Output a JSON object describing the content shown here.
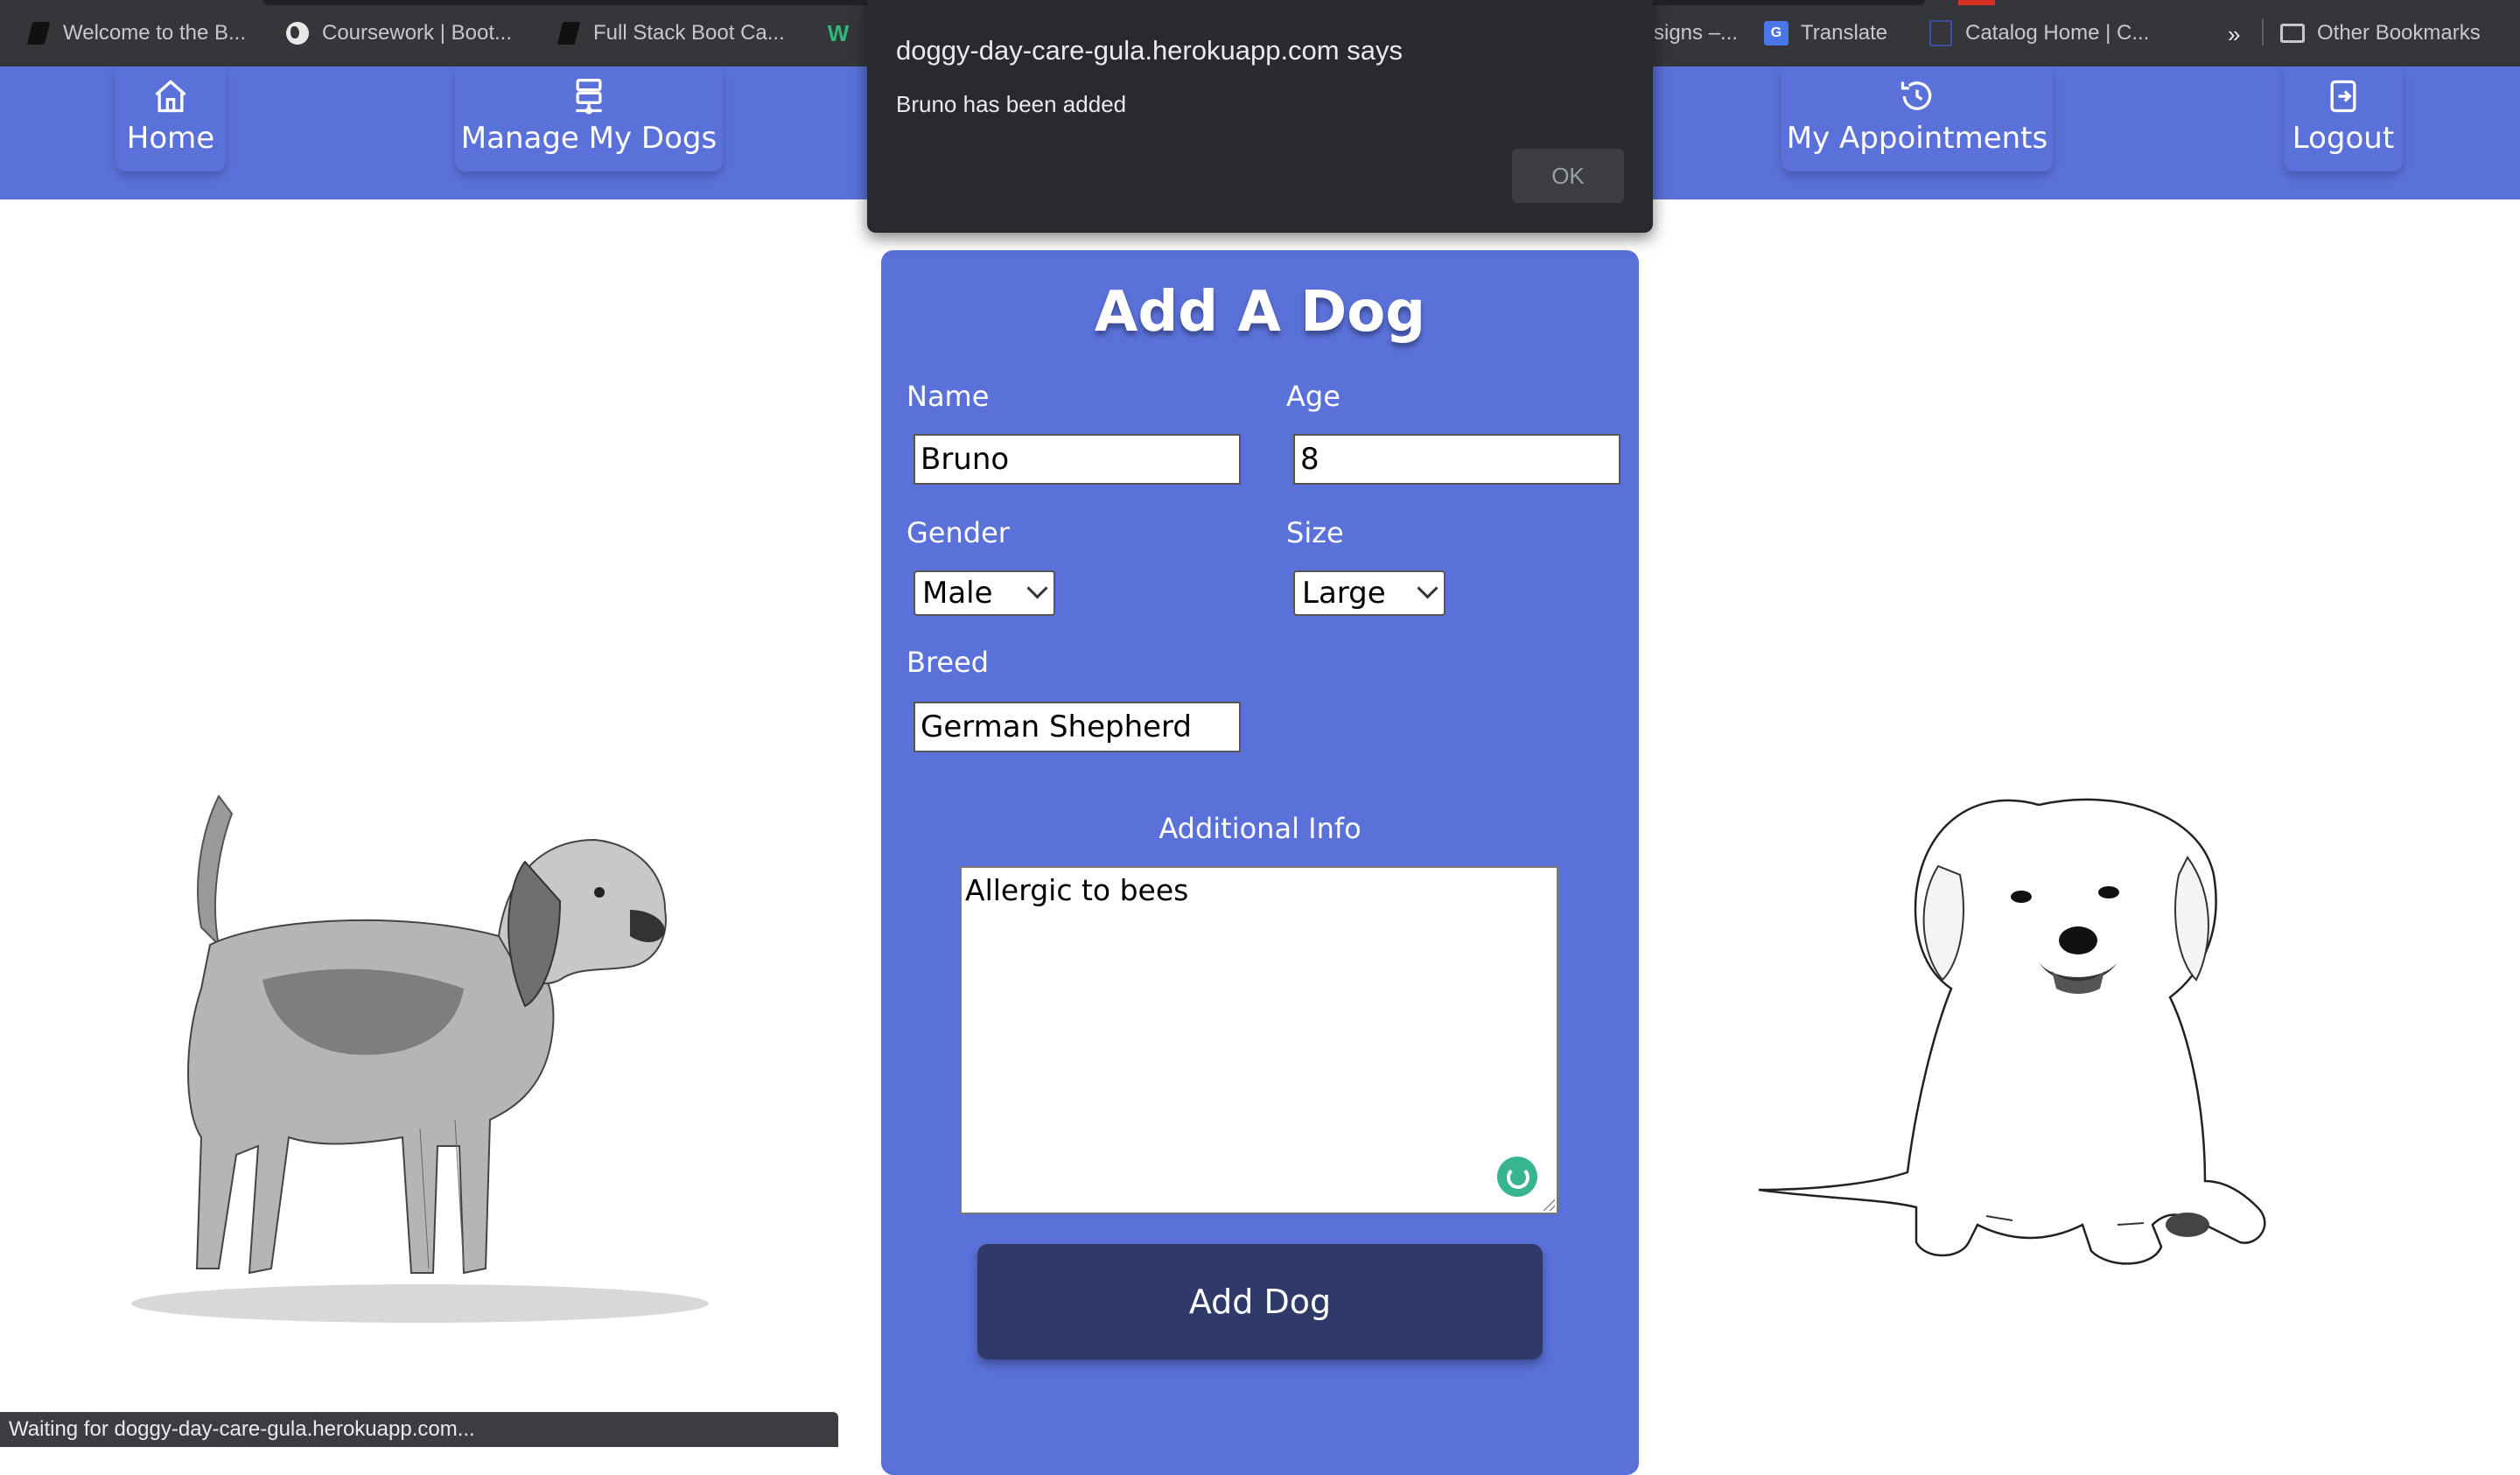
{
  "bookmarks": [
    {
      "label": "Welcome to the B...",
      "icon": "book-icon"
    },
    {
      "label": "Coursework | Boot...",
      "icon": "globe-icon"
    },
    {
      "label": "Full Stack Boot Ca...",
      "icon": "book-icon"
    },
    {
      "label": "W",
      "icon": "w-icon"
    },
    {
      "label": "signs –...",
      "icon": "none"
    },
    {
      "label": "Translate",
      "icon": "translate-icon"
    },
    {
      "label": "Catalog Home | C...",
      "icon": "catalog-icon"
    },
    {
      "label": "»",
      "icon": "overflow-chevron"
    },
    {
      "label": "Other Bookmarks",
      "icon": "folder-icon"
    }
  ],
  "nav": {
    "home": "Home",
    "manage": "Manage My Dogs",
    "appointments": "My Appointments",
    "logout": "Logout"
  },
  "form": {
    "title": "Add A Dog",
    "name_label": "Name",
    "name_value": "Bruno",
    "age_label": "Age",
    "age_value": "8",
    "gender_label": "Gender",
    "gender_value": "Male",
    "size_label": "Size",
    "size_value": "Large",
    "breed_label": "Breed",
    "breed_value": "German Shepherd",
    "info_label": "Additional Info",
    "info_value": "Allergic to bees",
    "submit_label": "Add Dog"
  },
  "dialog": {
    "title": "doggy-day-care-gula.herokuapp.com says",
    "message": "Bruno has been added",
    "ok_label": "OK"
  },
  "status_bar": "Waiting for doggy-day-care-gula.herokuapp.com...",
  "colors": {
    "nav_bg": "#5a71d9",
    "card_bg": "#5a71d9",
    "button_bg": "#2f3a6b",
    "dialog_bg": "#292a2d"
  }
}
